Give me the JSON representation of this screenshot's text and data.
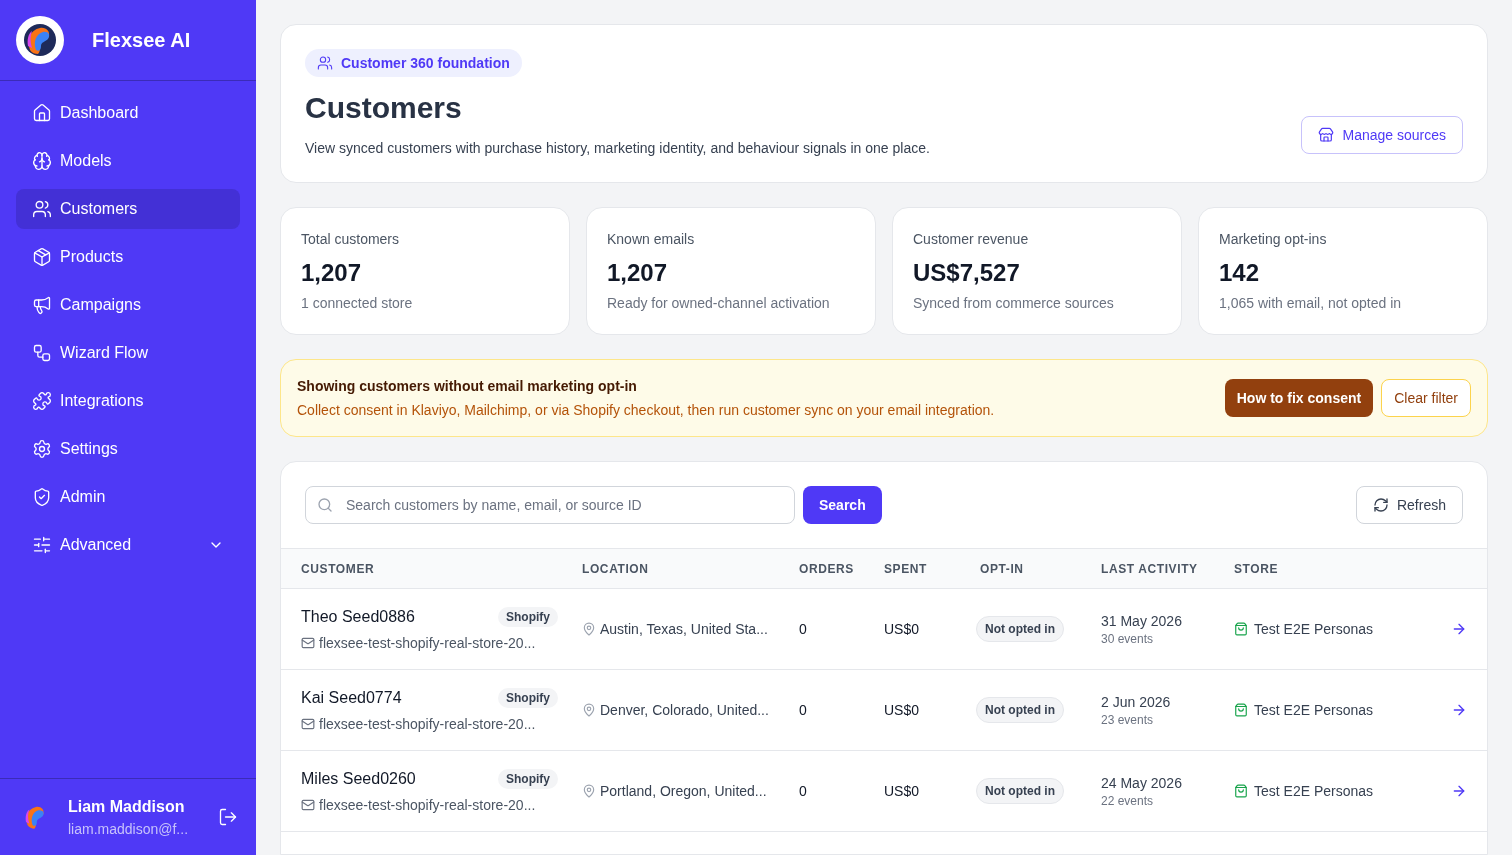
{
  "brand": {
    "name": "Flexsee AI"
  },
  "nav": [
    {
      "label": "Dashboard",
      "kind": "home",
      "selected": false
    },
    {
      "label": "Models",
      "kind": "brain",
      "selected": false
    },
    {
      "label": "Customers",
      "kind": "users",
      "selected": true
    },
    {
      "label": "Products",
      "kind": "package",
      "selected": false
    },
    {
      "label": "Campaigns",
      "kind": "megaphone",
      "selected": false
    },
    {
      "label": "Wizard Flow",
      "kind": "workflow",
      "selected": false
    },
    {
      "label": "Integrations",
      "kind": "puzzle",
      "selected": false
    },
    {
      "label": "Settings",
      "kind": "settings",
      "selected": false
    },
    {
      "label": "Admin",
      "kind": "shield",
      "selected": false
    },
    {
      "label": "Advanced",
      "kind": "sliders",
      "selected": false,
      "expanded": false
    }
  ],
  "user": {
    "name": "Liam Maddison",
    "email": "liam.maddison@f..."
  },
  "header": {
    "badge": "Customer 360 foundation",
    "title": "Customers",
    "subtitle": "View synced customers with purchase history, marketing identity, and behaviour signals in one place.",
    "button": "Manage sources"
  },
  "stats": [
    {
      "label": "Total customers",
      "value": "1,207",
      "note": "1 connected store"
    },
    {
      "label": "Known emails",
      "value": "1,207",
      "note": "Ready for owned-channel activation"
    },
    {
      "label": "Customer revenue",
      "value": "US$7,527",
      "note": "Synced from commerce sources"
    },
    {
      "label": "Marketing opt-ins",
      "value": "142",
      "note": "1,065 with email, not opted in"
    }
  ],
  "banner": {
    "title": "Showing customers without email marketing opt-in",
    "text": "Collect consent in Klaviyo, Mailchimp, or via Shopify checkout, then run customer sync on your email integration.",
    "primary": "How to fix consent",
    "secondary": "Clear filter"
  },
  "search": {
    "placeholder": "Search customers by name, email, or source ID",
    "button": "Search",
    "refresh": "Refresh"
  },
  "table": {
    "columns": [
      "CUSTOMER",
      "LOCATION",
      "ORDERS",
      "SPENT",
      "OPT-IN",
      "LAST ACTIVITY",
      "STORE"
    ],
    "rows": [
      {
        "name": "Theo Seed0886",
        "source": "Shopify",
        "email": "flexsee-test-shopify-real-store-20...",
        "location": "Austin, Texas, United Sta...",
        "orders": "0",
        "spent": "US$0",
        "optin": "Not opted in",
        "opted_in": false,
        "date": "31 May 2026",
        "events": "30 events",
        "store": "Test E2E Personas"
      },
      {
        "name": "Kai Seed0774",
        "source": "Shopify",
        "email": "flexsee-test-shopify-real-store-20...",
        "location": "Denver, Colorado, United...",
        "orders": "0",
        "spent": "US$0",
        "optin": "Not opted in",
        "opted_in": false,
        "date": "2 Jun 2026",
        "events": "23 events",
        "store": "Test E2E Personas"
      },
      {
        "name": "Miles Seed0260",
        "source": "Shopify",
        "email": "flexsee-test-shopify-real-store-20...",
        "location": "Portland, Oregon, United...",
        "orders": "0",
        "spent": "US$0",
        "optin": "Not opted in",
        "opted_in": false,
        "date": "24 May 2026",
        "events": "22 events",
        "store": "Test E2E Personas"
      }
    ]
  }
}
